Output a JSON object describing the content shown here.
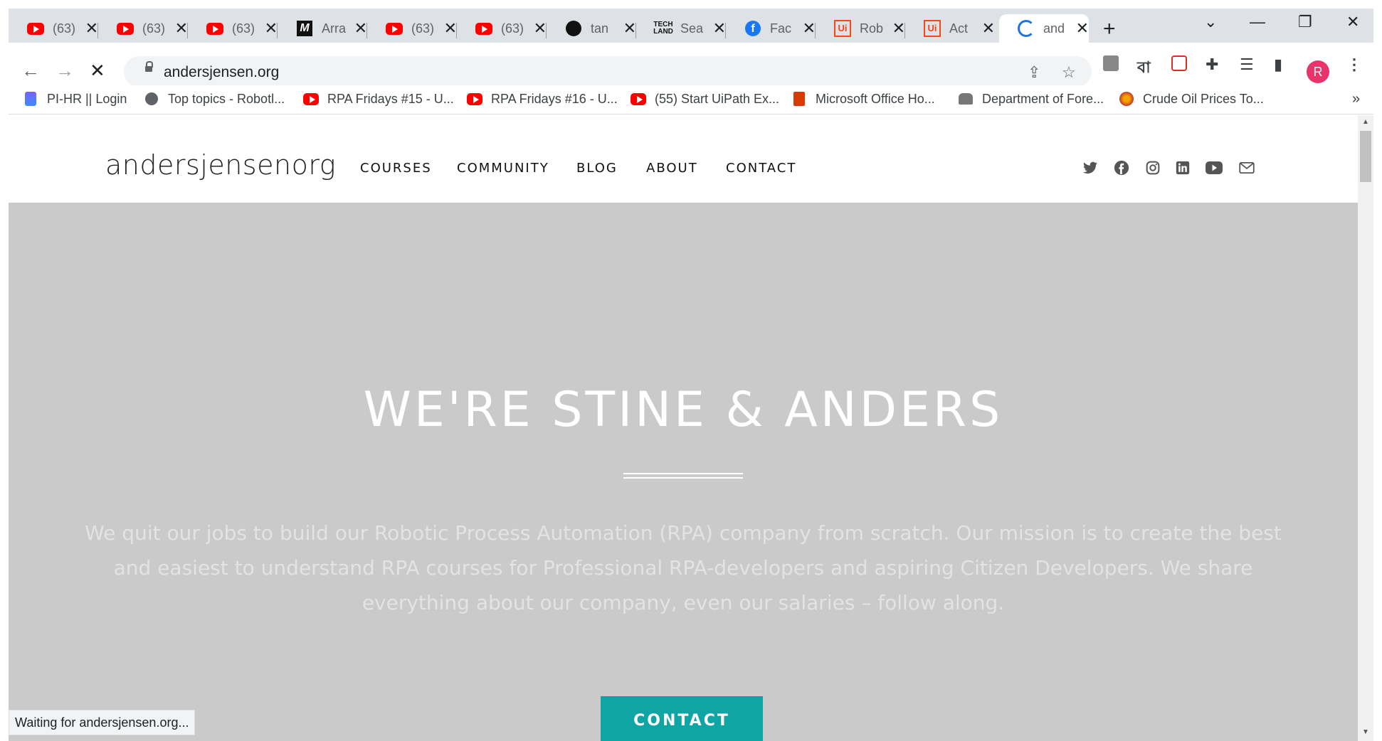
{
  "tabs": [
    {
      "label": "(63)",
      "icon": "youtube-icon"
    },
    {
      "label": "(63)",
      "icon": "youtube-icon"
    },
    {
      "label": "(63)",
      "icon": "youtube-icon"
    },
    {
      "label": "Arra",
      "icon": "medium-icon"
    },
    {
      "label": "(63)",
      "icon": "youtube-icon"
    },
    {
      "label": "(63)",
      "icon": "youtube-icon"
    },
    {
      "label": "tan",
      "icon": "github-icon"
    },
    {
      "label": "Sea",
      "icon": "techland-icon"
    },
    {
      "label": "Fac",
      "icon": "facebook-icon"
    },
    {
      "label": "Rob",
      "icon": "uipath-icon"
    },
    {
      "label": "Act",
      "icon": "uipath-icon"
    },
    {
      "label": "and",
      "icon": "loading-icon"
    }
  ],
  "toolbar": {
    "url": "andersjensen.org",
    "profile_initial": "R"
  },
  "bookmarks": [
    {
      "label": "PI-HR || Login"
    },
    {
      "label": "Top topics - Robotl..."
    },
    {
      "label": "RPA Fridays #15 - U..."
    },
    {
      "label": "RPA Fridays #16 - U..."
    },
    {
      "label": "(55) Start UiPath Ex..."
    },
    {
      "label": "Microsoft Office Ho..."
    },
    {
      "label": "Department of Fore..."
    },
    {
      "label": "Crude Oil Prices To..."
    }
  ],
  "site": {
    "logo": "andersjensenorg",
    "nav": [
      "COURSES",
      "COMMUNITY",
      "BLOG",
      "ABOUT",
      "CONTACT"
    ],
    "hero_title": "WE'RE STINE & ANDERS",
    "hero_text": "We quit our jobs to build our Robotic Process Automation (RPA) company from scratch. Our mission is to create the best and easiest to understand RPA courses for Professional RPA-developers and aspiring Citizen Developers. We share everything about our company, even our salaries – follow along.",
    "cta_label": "CONTACT"
  },
  "status_text": "Waiting for andersjensen.org...",
  "colors": {
    "accent": "#10a5a5",
    "hero_bg": "#cacaca",
    "tabstrip_bg": "#dee1e6",
    "profile_bg": "#e8336b"
  }
}
